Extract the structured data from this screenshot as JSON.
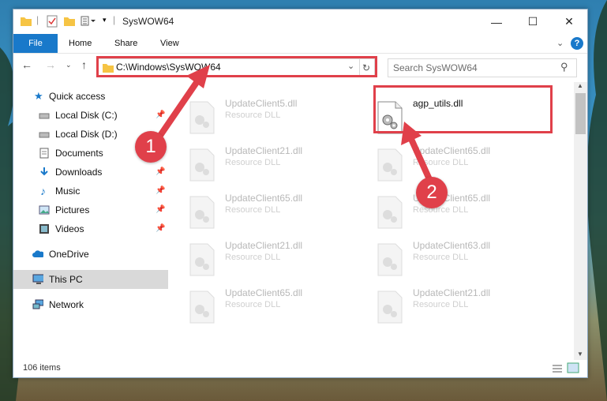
{
  "window": {
    "title": "SysWOW64"
  },
  "ribbon": {
    "tabs": [
      "File",
      "Home",
      "Share",
      "View"
    ]
  },
  "address": {
    "path": "C:\\Windows\\SysWOW64",
    "search_placeholder": "Search SysWOW64"
  },
  "sidebar": {
    "items": [
      {
        "label": "Quick access",
        "icon": "star-icon",
        "pinned": false
      },
      {
        "label": "Local Disk (C:)",
        "icon": "drive-icon",
        "pinned": true
      },
      {
        "label": "Local Disk (D:)",
        "icon": "drive-icon",
        "pinned": false
      },
      {
        "label": "Documents",
        "icon": "documents-icon",
        "pinned": false
      },
      {
        "label": "Downloads",
        "icon": "download-icon",
        "pinned": true
      },
      {
        "label": "Music",
        "icon": "music-icon",
        "pinned": true
      },
      {
        "label": "Pictures",
        "icon": "pictures-icon",
        "pinned": true
      },
      {
        "label": "Videos",
        "icon": "videos-icon",
        "pinned": true
      },
      {
        "label": "OneDrive",
        "icon": "cloud-icon",
        "pinned": false
      },
      {
        "label": "This PC",
        "icon": "computer-icon",
        "selected": true
      },
      {
        "label": "Network",
        "icon": "network-icon",
        "pinned": false
      }
    ]
  },
  "files": [
    {
      "name": "UpdateClient5.dll",
      "type": "Resource DLL"
    },
    {
      "name": "agp_utils.dll",
      "type": ""
    },
    {
      "name": "UpdateClient21.dll",
      "type": "Resource DLL"
    },
    {
      "name": "UpdateClient65.dll",
      "type": "Resource DLL"
    },
    {
      "name": "UpdateClient65.dll",
      "type": "Resource DLL"
    },
    {
      "name": "UpdateClient65.dll",
      "type": "Resource DLL"
    },
    {
      "name": "UpdateClient21.dll",
      "type": "Resource DLL"
    },
    {
      "name": "UpdateClient63.dll",
      "type": "Resource DLL"
    },
    {
      "name": "UpdateClient65.dll",
      "type": "Resource DLL"
    },
    {
      "name": "UpdateClient21.dll",
      "type": "Resource DLL"
    }
  ],
  "status": {
    "item_count": "106 items"
  },
  "annotations": {
    "step1": "1",
    "step2": "2"
  },
  "colors": {
    "accent": "#1979ca",
    "annotation": "#e0404a"
  }
}
